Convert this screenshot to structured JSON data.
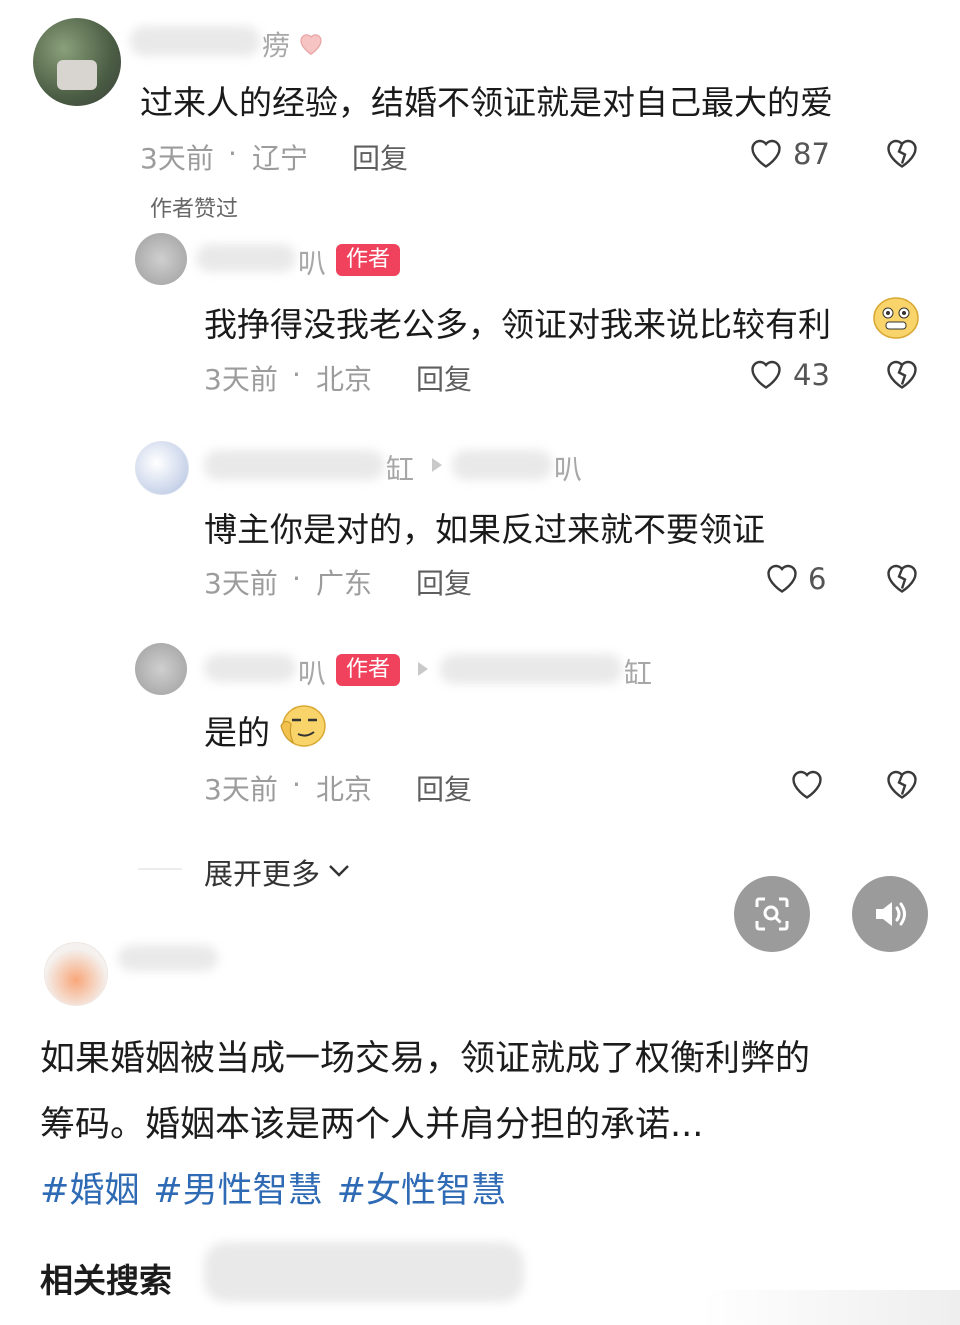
{
  "comments": [
    {
      "name_tail": "痨",
      "text": "过来人的经验，结婚不领证就是对自己最大的爱",
      "time": "3天前",
      "location": "辽宁",
      "reply": "回复",
      "likes": "87",
      "author_liked": "作者赞过"
    },
    {
      "name_tail": "叭",
      "author_tag": "作者",
      "text": "我挣得没我老公多，领证对我来说比较有利",
      "time": "3天前",
      "location": "北京",
      "reply": "回复",
      "likes": "43"
    },
    {
      "name_tail": "缸",
      "reply_to_tail": "叭",
      "text": "博主你是对的，如果反过来就不要领证",
      "time": "3天前",
      "location": "广东",
      "reply": "回复",
      "likes": "6"
    },
    {
      "name_tail": "叭",
      "author_tag": "作者",
      "reply_to_tail": "缸",
      "text": "是的",
      "time": "3天前",
      "location": "北京",
      "reply": "回复",
      "likes": ""
    }
  ],
  "expand_more": "展开更多",
  "meta_separator": "·",
  "post": {
    "text_line1": "如果婚姻被当成一场交易，领证就成了权衡利弊的",
    "text_line2": "筹码。婚姻本该是两个人并肩分担的承诺...",
    "hashtags": [
      "#婚姻",
      "#男性智慧",
      "#女性智慧"
    ]
  },
  "related_search_label": "相关搜索",
  "icons": {
    "like": "heart-outline-icon",
    "dislike": "broken-heart-icon",
    "lens": "image-search-icon",
    "sound": "speaker-icon",
    "expand": "chevron-down-icon"
  }
}
